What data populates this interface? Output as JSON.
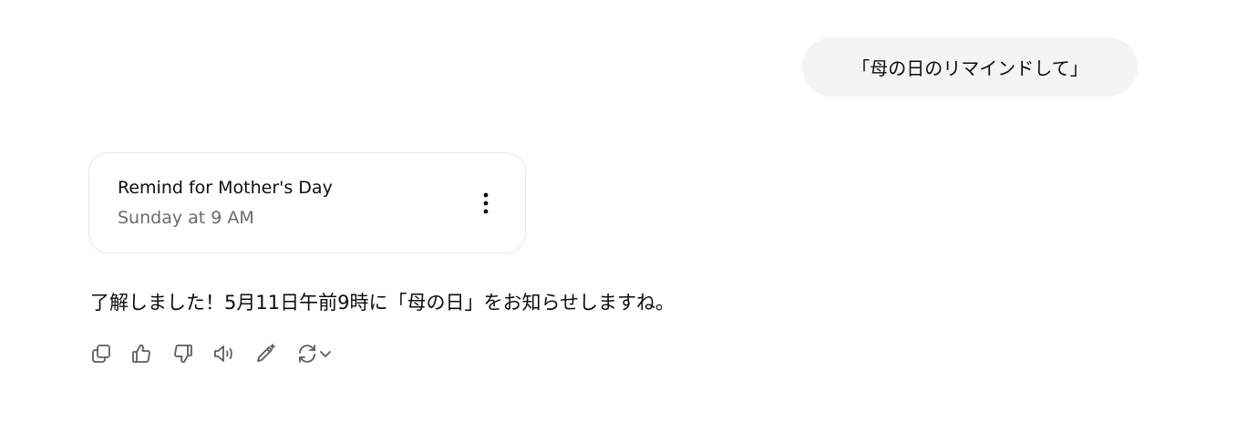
{
  "user_message": {
    "text": "「母の日のリマインドして」"
  },
  "reminder_card": {
    "title": "Remind for Mother's Day",
    "schedule": "Sunday at 9 AM",
    "menu_icon": "more-vertical-icon"
  },
  "assistant_message": {
    "text": "了解しました！5月11日午前9時に「母の日」をお知らせしますね。"
  },
  "action_bar": {
    "icons": [
      "copy-icon",
      "thumbs-up-icon",
      "thumbs-down-icon",
      "read-aloud-icon",
      "edit-icon",
      "regenerate-icon",
      "chevron-down-icon"
    ]
  },
  "colors": {
    "bubble_background": "#f4f4f4",
    "card_border": "#e6e6e6",
    "secondary_text": "#6b6b6b",
    "icon": "#5d5d5d"
  }
}
